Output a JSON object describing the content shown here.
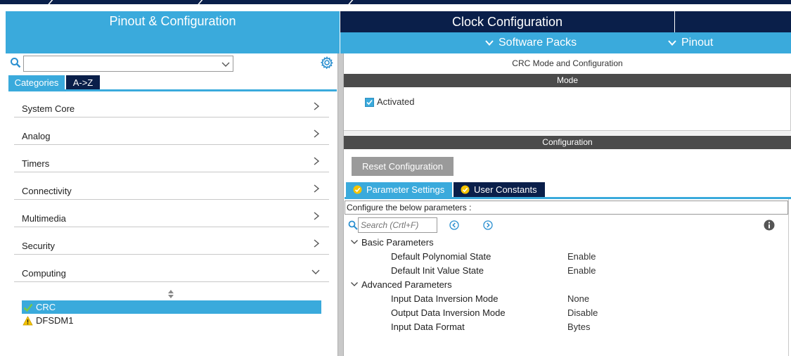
{
  "tabs": {
    "pinout": "Pinout & Configuration",
    "clock": "Clock Configuration"
  },
  "menu": {
    "software_packs": "Software Packs",
    "pinout": "Pinout"
  },
  "left": {
    "search_value": "",
    "subtabs": {
      "categories": "Categories",
      "az": "A->Z"
    },
    "categories": [
      {
        "label": "System Core",
        "expanded": false
      },
      {
        "label": "Analog",
        "expanded": false
      },
      {
        "label": "Timers",
        "expanded": false
      },
      {
        "label": "Connectivity",
        "expanded": false
      },
      {
        "label": "Multimedia",
        "expanded": false
      },
      {
        "label": "Security",
        "expanded": false
      },
      {
        "label": "Computing",
        "expanded": true
      }
    ],
    "computing_items": [
      {
        "label": "CRC",
        "status": "ok",
        "selected": true
      },
      {
        "label": "DFSDM1",
        "status": "warning",
        "selected": false
      }
    ]
  },
  "right": {
    "title": "CRC Mode and Configuration",
    "mode_header": "Mode",
    "activated_label": "Activated",
    "activated": true,
    "config_header": "Configuration",
    "reset_label": "Reset Configuration",
    "tabs": {
      "parameter_settings": "Parameter Settings",
      "user_constants": "User Constants"
    },
    "hint": "Configure the below parameters :",
    "search_placeholder": "Search (Crtl+F)",
    "groups": [
      {
        "name": "Basic Parameters",
        "params": [
          {
            "name": "Default Polynomial State",
            "value": "Enable"
          },
          {
            "name": "Default Init Value State",
            "value": "Enable"
          }
        ]
      },
      {
        "name": "Advanced Parameters",
        "params": [
          {
            "name": "Input Data Inversion Mode",
            "value": "None"
          },
          {
            "name": "Output Data Inversion Mode",
            "value": "Disable"
          },
          {
            "name": "Input Data Format",
            "value": "Bytes"
          }
        ]
      }
    ]
  },
  "colors": {
    "accent": "#3aaadc",
    "navy": "#0a1f4a",
    "header_gray": "#4b4b4b",
    "ok_green": "#7ac943",
    "warn_yellow": "#f5c400"
  }
}
